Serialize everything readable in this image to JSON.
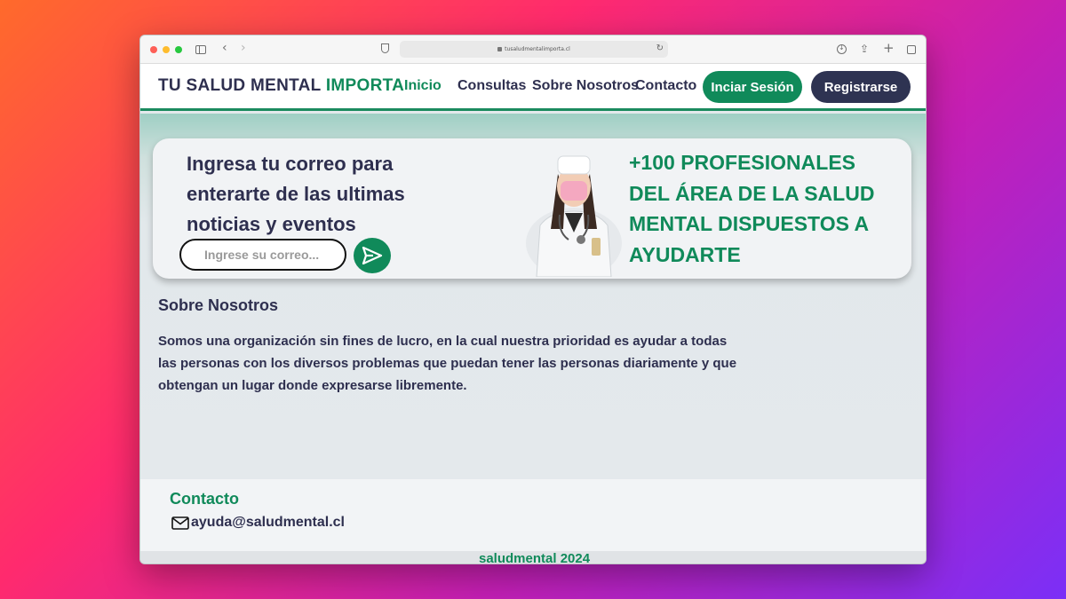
{
  "browser": {
    "url": "tusaludmentalimporta.cl"
  },
  "header": {
    "logo_main": "TU SALUD MENTAL ",
    "logo_highlight": "IMPORTA",
    "nav": {
      "inicio": "Inicio",
      "consultas": "Consultas",
      "sobre": "Sobre Nosotros",
      "contacto": "Contacto"
    },
    "login_label": "Inciar Sesión",
    "register_label": "Registrarse"
  },
  "hero": {
    "text": "Ingresa tu correo para enterarte de las ultimas noticias y eventos",
    "email_placeholder": "Ingrese su correo...",
    "headline": "+100 PROFESIONALES DEL ÁREA DE LA SALUD MENTAL DISPUESTOS A AYUDARTE"
  },
  "about": {
    "title": "Sobre Nosotros",
    "text": "Somos una organización sin fines de lucro, en la cual nuestra prioridad es ayudar a todas las personas con los diversos problemas que puedan tener las personas diariamente y que obtengan un lugar donde expresarse libremente."
  },
  "footer": {
    "contact_title": "Contacto",
    "email": "ayuda@saludmental.cl",
    "copyright": "saludmental 2024"
  },
  "colors": {
    "brand_green": "#108a5a",
    "navy": "#2e3352"
  }
}
